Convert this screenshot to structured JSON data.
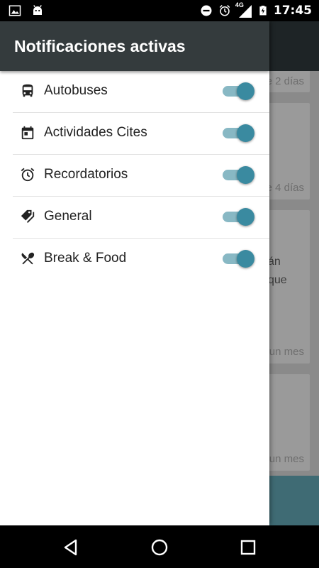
{
  "status_bar": {
    "time": "17:45",
    "network": "4G",
    "icons": [
      "image-icon",
      "android-icon",
      "do-not-disturb-icon",
      "alarm-icon",
      "signal-icon",
      "battery-charging-icon"
    ]
  },
  "drawer": {
    "title": "Notificaciones activas",
    "items": [
      {
        "label": "Autobuses",
        "icon": "bus-icon",
        "enabled": true
      },
      {
        "label": "Actividades Cites",
        "icon": "calendar-icon",
        "enabled": true
      },
      {
        "label": "Recordatorios",
        "icon": "alarm-icon",
        "enabled": true
      },
      {
        "label": "General",
        "icon": "tags-icon",
        "enabled": true
      },
      {
        "label": "Break & Food",
        "icon": "fork-knife-icon",
        "enabled": true
      }
    ]
  },
  "background": {
    "card1_meta": "e 2 días",
    "card2_meta": "e 4 días",
    "card3_line1": "án",
    "card3_line2": "que",
    "card3_meta": "un mes",
    "card4_meta": "un mes"
  },
  "nav_bar": {
    "icons": [
      "back-icon",
      "home-icon",
      "recents-icon"
    ]
  },
  "colors": {
    "accent": "#3a8aa0",
    "track": "#88b8c4",
    "header": "#343b3d"
  }
}
